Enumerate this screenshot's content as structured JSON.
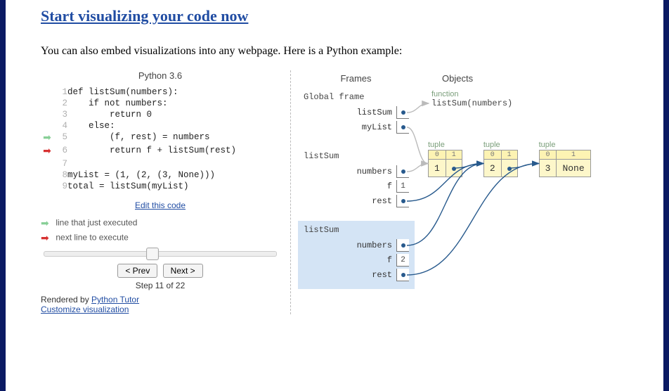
{
  "headline": "Start visualizing your code now",
  "intro": "You can also embed visualizations into any webpage. Here is a Python example:",
  "viz": {
    "lang_title": "Python 3.6",
    "code_lines": [
      "def listSum(numbers):",
      "    if not numbers:",
      "        return 0",
      "    else:",
      "        (f, rest) = numbers",
      "        return f + listSum(rest)",
      "",
      "myList = (1, (2, (3, None)))",
      "total = listSum(myList)"
    ],
    "prev_exec_line": 5,
    "next_exec_line": 6,
    "edit_link": "Edit this code",
    "legend_prev": "line that just executed",
    "legend_next": "next line to execute",
    "btn_prev": "< Prev",
    "btn_next": "Next >",
    "step_label": "Step 11 of 22",
    "step_current": 11,
    "step_total": 22,
    "rendered_prefix": "Rendered by ",
    "rendered_link": "Python Tutor",
    "customize_link": "Customize visualization"
  },
  "heap": {
    "frames_header": "Frames",
    "objects_header": "Objects",
    "global_title": "Global frame",
    "frames": [
      {
        "name": "Global frame",
        "active": false,
        "vars": [
          {
            "name": "listSum",
            "type": "ref"
          },
          {
            "name": "myList",
            "type": "ref"
          }
        ]
      },
      {
        "name": "listSum",
        "active": false,
        "vars": [
          {
            "name": "numbers",
            "type": "ref"
          },
          {
            "name": "f",
            "type": "val",
            "value": "1"
          },
          {
            "name": "rest",
            "type": "ref"
          }
        ]
      },
      {
        "name": "listSum",
        "active": true,
        "vars": [
          {
            "name": "numbers",
            "type": "ref"
          },
          {
            "name": "f",
            "type": "val",
            "value": "2"
          },
          {
            "name": "rest",
            "type": "ref"
          }
        ]
      }
    ],
    "func": {
      "label": "function",
      "text": "listSum(numbers)"
    },
    "tuples": [
      {
        "label": "tuple",
        "idx": [
          "0",
          "1"
        ],
        "val": [
          "1",
          "REF"
        ]
      },
      {
        "label": "tuple",
        "idx": [
          "0",
          "1"
        ],
        "val": [
          "2",
          "REF"
        ]
      },
      {
        "label": "tuple",
        "idx": [
          "0",
          "1"
        ],
        "val": [
          "3",
          "None"
        ]
      }
    ]
  }
}
